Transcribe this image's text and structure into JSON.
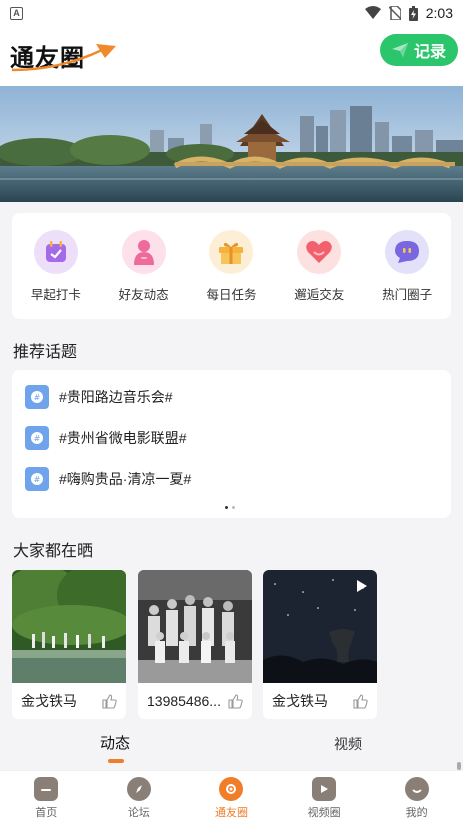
{
  "status_bar": {
    "time": "2:03"
  },
  "header": {
    "logo_text": "通友圈",
    "record_label": "记录"
  },
  "quick_actions": [
    {
      "label": "早起打卡",
      "icon": "calendar-check-icon",
      "color": "#a46be8",
      "bg": "#eddff9"
    },
    {
      "label": "好友动态",
      "icon": "person-icon",
      "color": "#ee6a9a",
      "bg": "#fde0ea"
    },
    {
      "label": "每日任务",
      "icon": "gift-icon",
      "color": "#f5b33a",
      "bg": "#fdefd6"
    },
    {
      "label": "邂逅交友",
      "icon": "heart-icon",
      "color": "#f2606b",
      "bg": "#fde1e1"
    },
    {
      "label": "热门圈子",
      "icon": "chat-bubble-icon",
      "color": "#7a66e0",
      "bg": "#e3e0fa"
    }
  ],
  "topics_title": "推荐话题",
  "topics": [
    "#贵阳路边音乐会#",
    "#贵州省微电影联盟#",
    "#嗨购贵品·清凉一夏#"
  ],
  "shares_title": "大家都在晒",
  "shares": [
    {
      "name": "金戈铁马",
      "type": "image"
    },
    {
      "name": "13985486...",
      "type": "image"
    },
    {
      "name": "金戈铁马",
      "type": "video"
    }
  ],
  "feed_tabs": {
    "active": "动态",
    "other": "视频"
  },
  "bottom_nav": [
    {
      "label": "首页",
      "icon": "home-icon"
    },
    {
      "label": "论坛",
      "icon": "compass-icon"
    },
    {
      "label": "通友圈",
      "icon": "circle-icon",
      "active": true
    },
    {
      "label": "视频圈",
      "icon": "video-icon"
    },
    {
      "label": "我的",
      "icon": "profile-icon"
    }
  ]
}
